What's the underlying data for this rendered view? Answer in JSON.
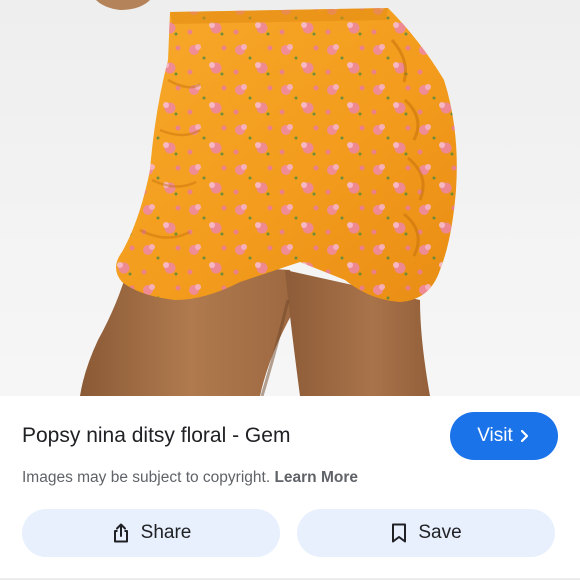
{
  "result": {
    "title": "Popsy nina ditsy floral - Gem",
    "image_description_icon": "product-photo",
    "visit_label": "Visit",
    "copyright_text": "Images may be subject to copyright.",
    "learn_more_label": "Learn More"
  },
  "actions": {
    "share_label": "Share",
    "save_label": "Save"
  },
  "colors": {
    "visit_button": "#1a73e8",
    "action_button_bg": "#e8f0fe",
    "skirt": "#f4a024",
    "text_primary": "#202124",
    "text_secondary": "#5f6368"
  },
  "icons": {
    "visit": "chevron-right-icon",
    "share": "share-icon",
    "save": "bookmark-icon"
  }
}
